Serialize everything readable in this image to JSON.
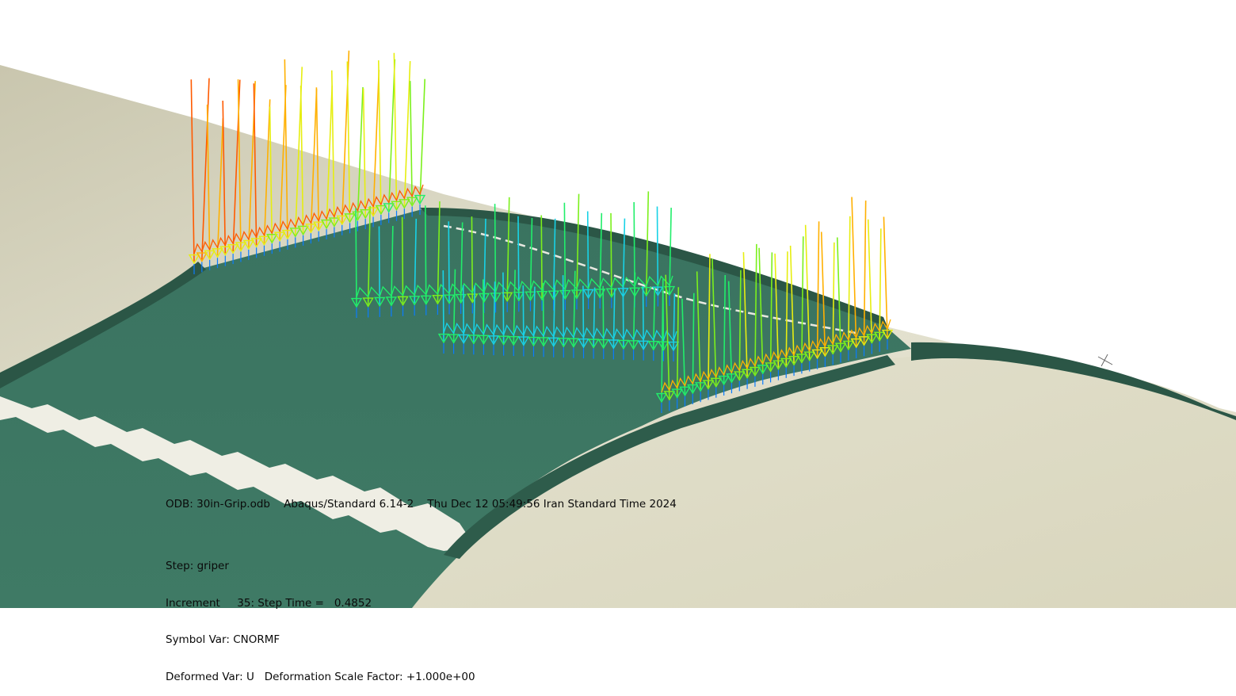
{
  "viewport": {
    "background_color": "#ffffff",
    "body_color": "#3d7763",
    "body_dark_color": "#2b5646",
    "roller_color": "#dedcc6",
    "roller_shade_color": "#bdb99f",
    "ridge_color": "#efeee4",
    "arrow_colormap": [
      "#0033d9",
      "#0a7cff",
      "#18d2e6",
      "#21ee6a",
      "#7bf01c",
      "#e6ee10",
      "#ffb000",
      "#ff5a00",
      "#e11a00"
    ]
  },
  "symbol_plot": {
    "variable": "CNORMF",
    "arrow_groups": [
      {
        "name": "group-top-left",
        "intensity": 0.82
      },
      {
        "name": "group-middle-upper",
        "intensity": 0.38
      },
      {
        "name": "group-middle-lower",
        "intensity": 0.3
      },
      {
        "name": "group-right",
        "intensity": 0.72
      }
    ]
  },
  "info": {
    "odb_line": "ODB: 30in-Grip.odb    Abaqus/Standard 6.14-2    Thu Dec 12 05:49:56 Iran Standard Time 2024",
    "step": "Step: griper",
    "increment": "Increment     35: Step Time =   0.4852",
    "symbol_var": "Symbol Var: CNORMF",
    "deformed_var": "Deformed Var: U   Deformation Scale Factor: +1.000e+00"
  }
}
